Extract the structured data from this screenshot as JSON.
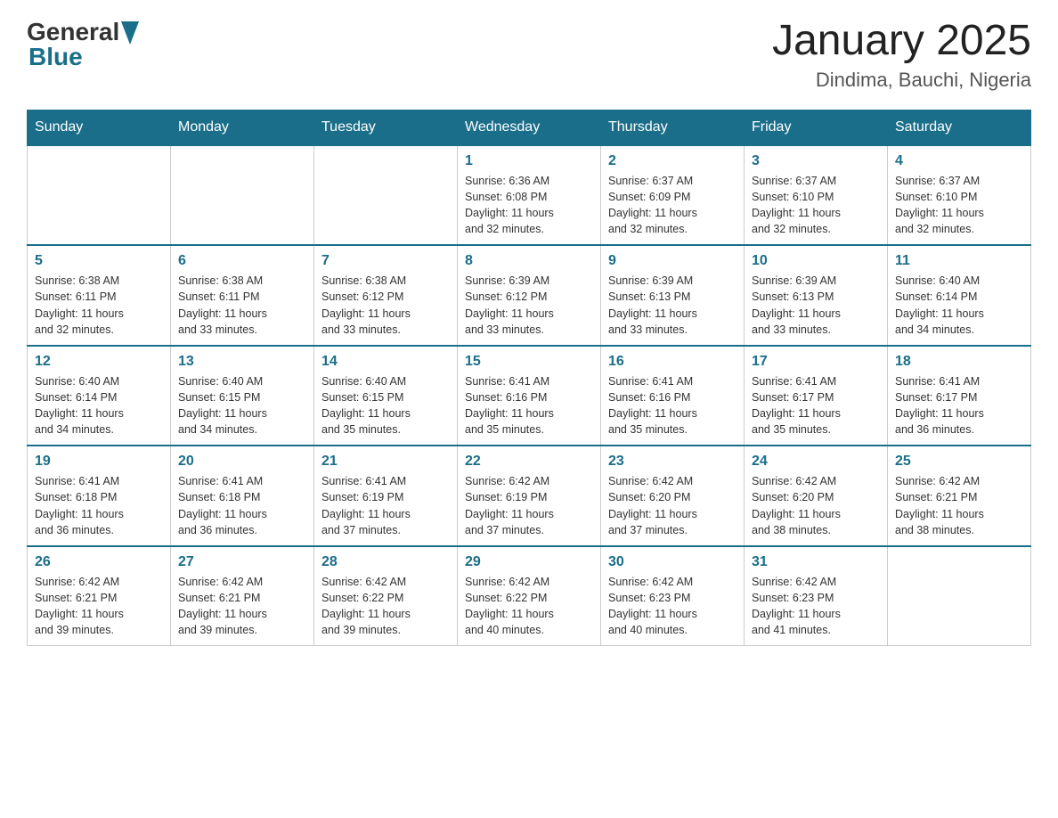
{
  "header": {
    "logo_general": "General",
    "logo_blue": "Blue",
    "month_title": "January 2025",
    "location": "Dindima, Bauchi, Nigeria"
  },
  "days_of_week": [
    "Sunday",
    "Monday",
    "Tuesday",
    "Wednesday",
    "Thursday",
    "Friday",
    "Saturday"
  ],
  "weeks": [
    [
      {
        "day": "",
        "info": ""
      },
      {
        "day": "",
        "info": ""
      },
      {
        "day": "",
        "info": ""
      },
      {
        "day": "1",
        "info": "Sunrise: 6:36 AM\nSunset: 6:08 PM\nDaylight: 11 hours\nand 32 minutes."
      },
      {
        "day": "2",
        "info": "Sunrise: 6:37 AM\nSunset: 6:09 PM\nDaylight: 11 hours\nand 32 minutes."
      },
      {
        "day": "3",
        "info": "Sunrise: 6:37 AM\nSunset: 6:10 PM\nDaylight: 11 hours\nand 32 minutes."
      },
      {
        "day": "4",
        "info": "Sunrise: 6:37 AM\nSunset: 6:10 PM\nDaylight: 11 hours\nand 32 minutes."
      }
    ],
    [
      {
        "day": "5",
        "info": "Sunrise: 6:38 AM\nSunset: 6:11 PM\nDaylight: 11 hours\nand 32 minutes."
      },
      {
        "day": "6",
        "info": "Sunrise: 6:38 AM\nSunset: 6:11 PM\nDaylight: 11 hours\nand 33 minutes."
      },
      {
        "day": "7",
        "info": "Sunrise: 6:38 AM\nSunset: 6:12 PM\nDaylight: 11 hours\nand 33 minutes."
      },
      {
        "day": "8",
        "info": "Sunrise: 6:39 AM\nSunset: 6:12 PM\nDaylight: 11 hours\nand 33 minutes."
      },
      {
        "day": "9",
        "info": "Sunrise: 6:39 AM\nSunset: 6:13 PM\nDaylight: 11 hours\nand 33 minutes."
      },
      {
        "day": "10",
        "info": "Sunrise: 6:39 AM\nSunset: 6:13 PM\nDaylight: 11 hours\nand 33 minutes."
      },
      {
        "day": "11",
        "info": "Sunrise: 6:40 AM\nSunset: 6:14 PM\nDaylight: 11 hours\nand 34 minutes."
      }
    ],
    [
      {
        "day": "12",
        "info": "Sunrise: 6:40 AM\nSunset: 6:14 PM\nDaylight: 11 hours\nand 34 minutes."
      },
      {
        "day": "13",
        "info": "Sunrise: 6:40 AM\nSunset: 6:15 PM\nDaylight: 11 hours\nand 34 minutes."
      },
      {
        "day": "14",
        "info": "Sunrise: 6:40 AM\nSunset: 6:15 PM\nDaylight: 11 hours\nand 35 minutes."
      },
      {
        "day": "15",
        "info": "Sunrise: 6:41 AM\nSunset: 6:16 PM\nDaylight: 11 hours\nand 35 minutes."
      },
      {
        "day": "16",
        "info": "Sunrise: 6:41 AM\nSunset: 6:16 PM\nDaylight: 11 hours\nand 35 minutes."
      },
      {
        "day": "17",
        "info": "Sunrise: 6:41 AM\nSunset: 6:17 PM\nDaylight: 11 hours\nand 35 minutes."
      },
      {
        "day": "18",
        "info": "Sunrise: 6:41 AM\nSunset: 6:17 PM\nDaylight: 11 hours\nand 36 minutes."
      }
    ],
    [
      {
        "day": "19",
        "info": "Sunrise: 6:41 AM\nSunset: 6:18 PM\nDaylight: 11 hours\nand 36 minutes."
      },
      {
        "day": "20",
        "info": "Sunrise: 6:41 AM\nSunset: 6:18 PM\nDaylight: 11 hours\nand 36 minutes."
      },
      {
        "day": "21",
        "info": "Sunrise: 6:41 AM\nSunset: 6:19 PM\nDaylight: 11 hours\nand 37 minutes."
      },
      {
        "day": "22",
        "info": "Sunrise: 6:42 AM\nSunset: 6:19 PM\nDaylight: 11 hours\nand 37 minutes."
      },
      {
        "day": "23",
        "info": "Sunrise: 6:42 AM\nSunset: 6:20 PM\nDaylight: 11 hours\nand 37 minutes."
      },
      {
        "day": "24",
        "info": "Sunrise: 6:42 AM\nSunset: 6:20 PM\nDaylight: 11 hours\nand 38 minutes."
      },
      {
        "day": "25",
        "info": "Sunrise: 6:42 AM\nSunset: 6:21 PM\nDaylight: 11 hours\nand 38 minutes."
      }
    ],
    [
      {
        "day": "26",
        "info": "Sunrise: 6:42 AM\nSunset: 6:21 PM\nDaylight: 11 hours\nand 39 minutes."
      },
      {
        "day": "27",
        "info": "Sunrise: 6:42 AM\nSunset: 6:21 PM\nDaylight: 11 hours\nand 39 minutes."
      },
      {
        "day": "28",
        "info": "Sunrise: 6:42 AM\nSunset: 6:22 PM\nDaylight: 11 hours\nand 39 minutes."
      },
      {
        "day": "29",
        "info": "Sunrise: 6:42 AM\nSunset: 6:22 PM\nDaylight: 11 hours\nand 40 minutes."
      },
      {
        "day": "30",
        "info": "Sunrise: 6:42 AM\nSunset: 6:23 PM\nDaylight: 11 hours\nand 40 minutes."
      },
      {
        "day": "31",
        "info": "Sunrise: 6:42 AM\nSunset: 6:23 PM\nDaylight: 11 hours\nand 41 minutes."
      },
      {
        "day": "",
        "info": ""
      }
    ]
  ]
}
